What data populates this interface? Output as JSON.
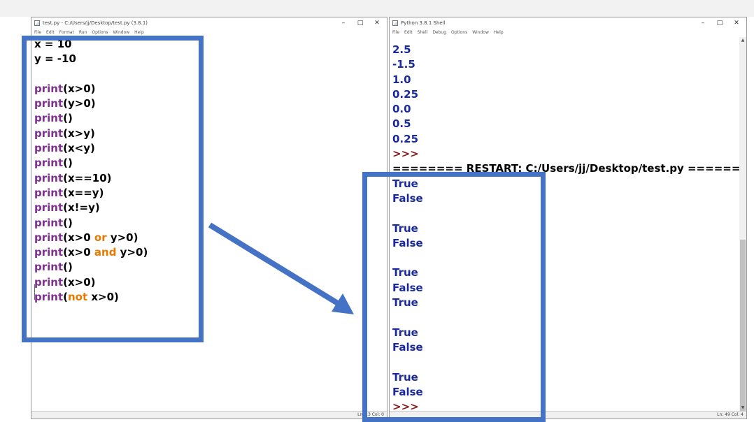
{
  "editor": {
    "title": "test.py - C:/Users/jj/Desktop/test.py (3.8.1)",
    "menu": [
      "File",
      "Edit",
      "Format",
      "Run",
      "Options",
      "Window",
      "Help"
    ],
    "status": "Ln: 13  Col: 0",
    "lines": [
      [
        {
          "t": "x = 10",
          "c": "tx"
        }
      ],
      [
        {
          "t": "y = -10",
          "c": "tx"
        }
      ],
      [],
      [
        {
          "t": "print",
          "c": "kw"
        },
        {
          "t": "(x>0)",
          "c": "tx"
        }
      ],
      [
        {
          "t": "print",
          "c": "kw"
        },
        {
          "t": "(y>0)",
          "c": "tx"
        }
      ],
      [
        {
          "t": "print",
          "c": "kw"
        },
        {
          "t": "()",
          "c": "tx"
        }
      ],
      [
        {
          "t": "print",
          "c": "kw"
        },
        {
          "t": "(x>y)",
          "c": "tx"
        }
      ],
      [
        {
          "t": "print",
          "c": "kw"
        },
        {
          "t": "(x<y)",
          "c": "tx"
        }
      ],
      [
        {
          "t": "print",
          "c": "kw"
        },
        {
          "t": "()",
          "c": "tx"
        }
      ],
      [
        {
          "t": "print",
          "c": "kw"
        },
        {
          "t": "(x==10)",
          "c": "tx"
        }
      ],
      [
        {
          "t": "print",
          "c": "kw"
        },
        {
          "t": "(x==y)",
          "c": "tx"
        }
      ],
      [
        {
          "t": "print",
          "c": "kw"
        },
        {
          "t": "(x!=y)",
          "c": "tx"
        }
      ],
      [
        {
          "t": "print",
          "c": "kw"
        },
        {
          "t": "()",
          "c": "tx"
        }
      ],
      [
        {
          "t": "print",
          "c": "kw"
        },
        {
          "t": "(x>0 ",
          "c": "tx"
        },
        {
          "t": "or",
          "c": "op"
        },
        {
          "t": " y>0)",
          "c": "tx"
        }
      ],
      [
        {
          "t": "print",
          "c": "kw"
        },
        {
          "t": "(x>0 ",
          "c": "tx"
        },
        {
          "t": "and",
          "c": "op"
        },
        {
          "t": " y>0)",
          "c": "tx"
        }
      ],
      [
        {
          "t": "print",
          "c": "kw"
        },
        {
          "t": "()",
          "c": "tx"
        }
      ],
      [
        {
          "t": "print",
          "c": "kw"
        },
        {
          "t": "(x>0)",
          "c": "tx"
        }
      ],
      [
        {
          "t": "print",
          "c": "kw"
        },
        {
          "t": "(",
          "c": "tx"
        },
        {
          "t": "not",
          "c": "op"
        },
        {
          "t": " x>0)",
          "c": "tx"
        }
      ]
    ]
  },
  "shell": {
    "title": "Python 3.8.1 Shell",
    "menu": [
      "File",
      "Edit",
      "Shell",
      "Debug",
      "Options",
      "Window",
      "Help"
    ],
    "status": "Ln: 49  Col: 4",
    "lines": [
      {
        "t": "2.5",
        "c": "out"
      },
      {
        "t": "-1.5",
        "c": "out"
      },
      {
        "t": "1.0",
        "c": "out"
      },
      {
        "t": "0.25",
        "c": "out"
      },
      {
        "t": "0.0",
        "c": "out"
      },
      {
        "t": "0.5",
        "c": "out"
      },
      {
        "t": "0.25",
        "c": "out"
      },
      {
        "t": ">>>",
        "c": "prompt"
      },
      {
        "t": "======== RESTART: C:/Users/jj/Desktop/test.py ========",
        "c": "restart"
      },
      {
        "t": "True",
        "c": "out"
      },
      {
        "t": "False",
        "c": "out"
      },
      {
        "t": "",
        "c": "out"
      },
      {
        "t": "True",
        "c": "out"
      },
      {
        "t": "False",
        "c": "out"
      },
      {
        "t": "",
        "c": "out"
      },
      {
        "t": "True",
        "c": "out"
      },
      {
        "t": "False",
        "c": "out"
      },
      {
        "t": "True",
        "c": "out"
      },
      {
        "t": "",
        "c": "out"
      },
      {
        "t": "True",
        "c": "out"
      },
      {
        "t": "False",
        "c": "out"
      },
      {
        "t": "",
        "c": "out"
      },
      {
        "t": "True",
        "c": "out"
      },
      {
        "t": "False",
        "c": "out"
      },
      {
        "t": ">>>",
        "c": "prompt"
      }
    ]
  },
  "window_controls": {
    "minimize": "–",
    "maximize": "□",
    "close": "✕"
  },
  "colors": {
    "highlight": "#4472c4",
    "keyword": "#7f2f8f",
    "operator": "#e67a00",
    "output": "#1a2a9e",
    "prompt": "#8b1a1a"
  },
  "annotations": [
    "highlight-box",
    "arrow"
  ]
}
